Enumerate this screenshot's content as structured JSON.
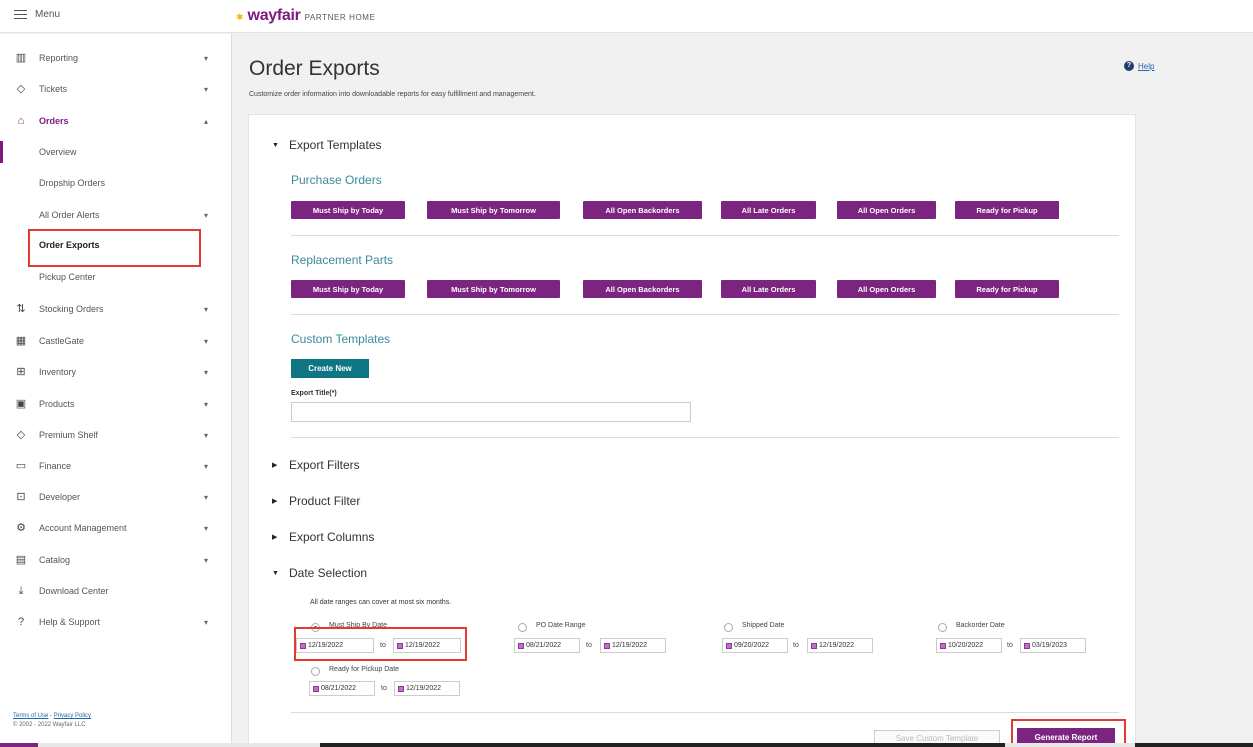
{
  "topbar": {
    "menu_label": "Menu",
    "logo_word": "wayfair",
    "logo_sub": "PARTNER HOME"
  },
  "sidebar": {
    "items": [
      {
        "label": "Reporting",
        "icon": "bar-chart-icon"
      },
      {
        "label": "Tickets",
        "icon": "tag-icon"
      },
      {
        "label": "Orders",
        "icon": "bag-icon"
      },
      {
        "label": "Overview"
      },
      {
        "label": "Dropship Orders"
      },
      {
        "label": "All Order Alerts"
      },
      {
        "label": "Order Exports"
      },
      {
        "label": "Pickup Center"
      },
      {
        "label": "Stocking Orders",
        "icon": "stocking-icon"
      },
      {
        "label": "CastleGate",
        "icon": "warehouse-icon"
      },
      {
        "label": "Inventory",
        "icon": "boxes-icon"
      },
      {
        "label": "Products",
        "icon": "products-icon"
      },
      {
        "label": "Premium Shelf",
        "icon": "tag-icon"
      },
      {
        "label": "Finance",
        "icon": "card-icon"
      },
      {
        "label": "Developer",
        "icon": "developer-icon"
      },
      {
        "label": "Account Management",
        "icon": "gear-icon"
      },
      {
        "label": "Catalog",
        "icon": "catalog-icon"
      },
      {
        "label": "Download Center",
        "icon": "download-icon"
      },
      {
        "label": "Help & Support",
        "icon": "help-icon"
      }
    ],
    "footer": {
      "terms": "Terms of Use",
      "sep": " - ",
      "privacy": "Privacy Policy",
      "copyright": "© 2002 - 2022 Wayfair LLC"
    }
  },
  "page": {
    "title": "Order Exports",
    "subtitle": "Customize order information into downloadable reports for easy fulfillment and management.",
    "help": "Help"
  },
  "export_templates": {
    "heading": "Export Templates",
    "purchase_orders": {
      "title": "Purchase Orders",
      "buttons": [
        "Must Ship by Today",
        "Must Ship by Tomorrow",
        "All Open Backorders",
        "All Late Orders",
        "All Open Orders",
        "Ready for Pickup"
      ]
    },
    "replacement_parts": {
      "title": "Replacement Parts",
      "buttons": [
        "Must Ship by Today",
        "Must Ship by Tomorrow",
        "All Open Backorders",
        "All Late Orders",
        "All Open Orders",
        "Ready for Pickup"
      ]
    },
    "custom": {
      "title": "Custom Templates",
      "create_label": "Create New",
      "field_label": "Export Title(*)",
      "field_value": ""
    }
  },
  "sections": {
    "filters": "Export Filters",
    "product_filter": "Product Filter",
    "columns": "Export Columns",
    "date_selection": "Date Selection"
  },
  "date_selection": {
    "note": "All date ranges can cover at most six months.",
    "to_label": "to",
    "options": [
      {
        "label": "Must Ship By Date",
        "from": "12/19/2022",
        "to": "12/19/2022",
        "selected": true
      },
      {
        "label": "PO Date Range",
        "from": "08/21/2022",
        "to": "12/19/2022",
        "selected": false
      },
      {
        "label": "Shipped Date",
        "from": "09/20/2022",
        "to": "12/19/2022",
        "selected": false
      },
      {
        "label": "Backorder Date",
        "from": "10/20/2022",
        "to": "03/19/2023",
        "selected": false
      },
      {
        "label": "Ready for Pickup Date",
        "from": "08/21/2022",
        "to": "12/19/2022",
        "selected": false
      }
    ]
  },
  "actions": {
    "save_template": "Save Custom Template",
    "generate": "Generate Report"
  },
  "colors": {
    "brand_purple": "#7b2580",
    "teal": "#0e7583",
    "highlight_red": "#e23a2e",
    "link_teal": "#3a8a9b"
  }
}
